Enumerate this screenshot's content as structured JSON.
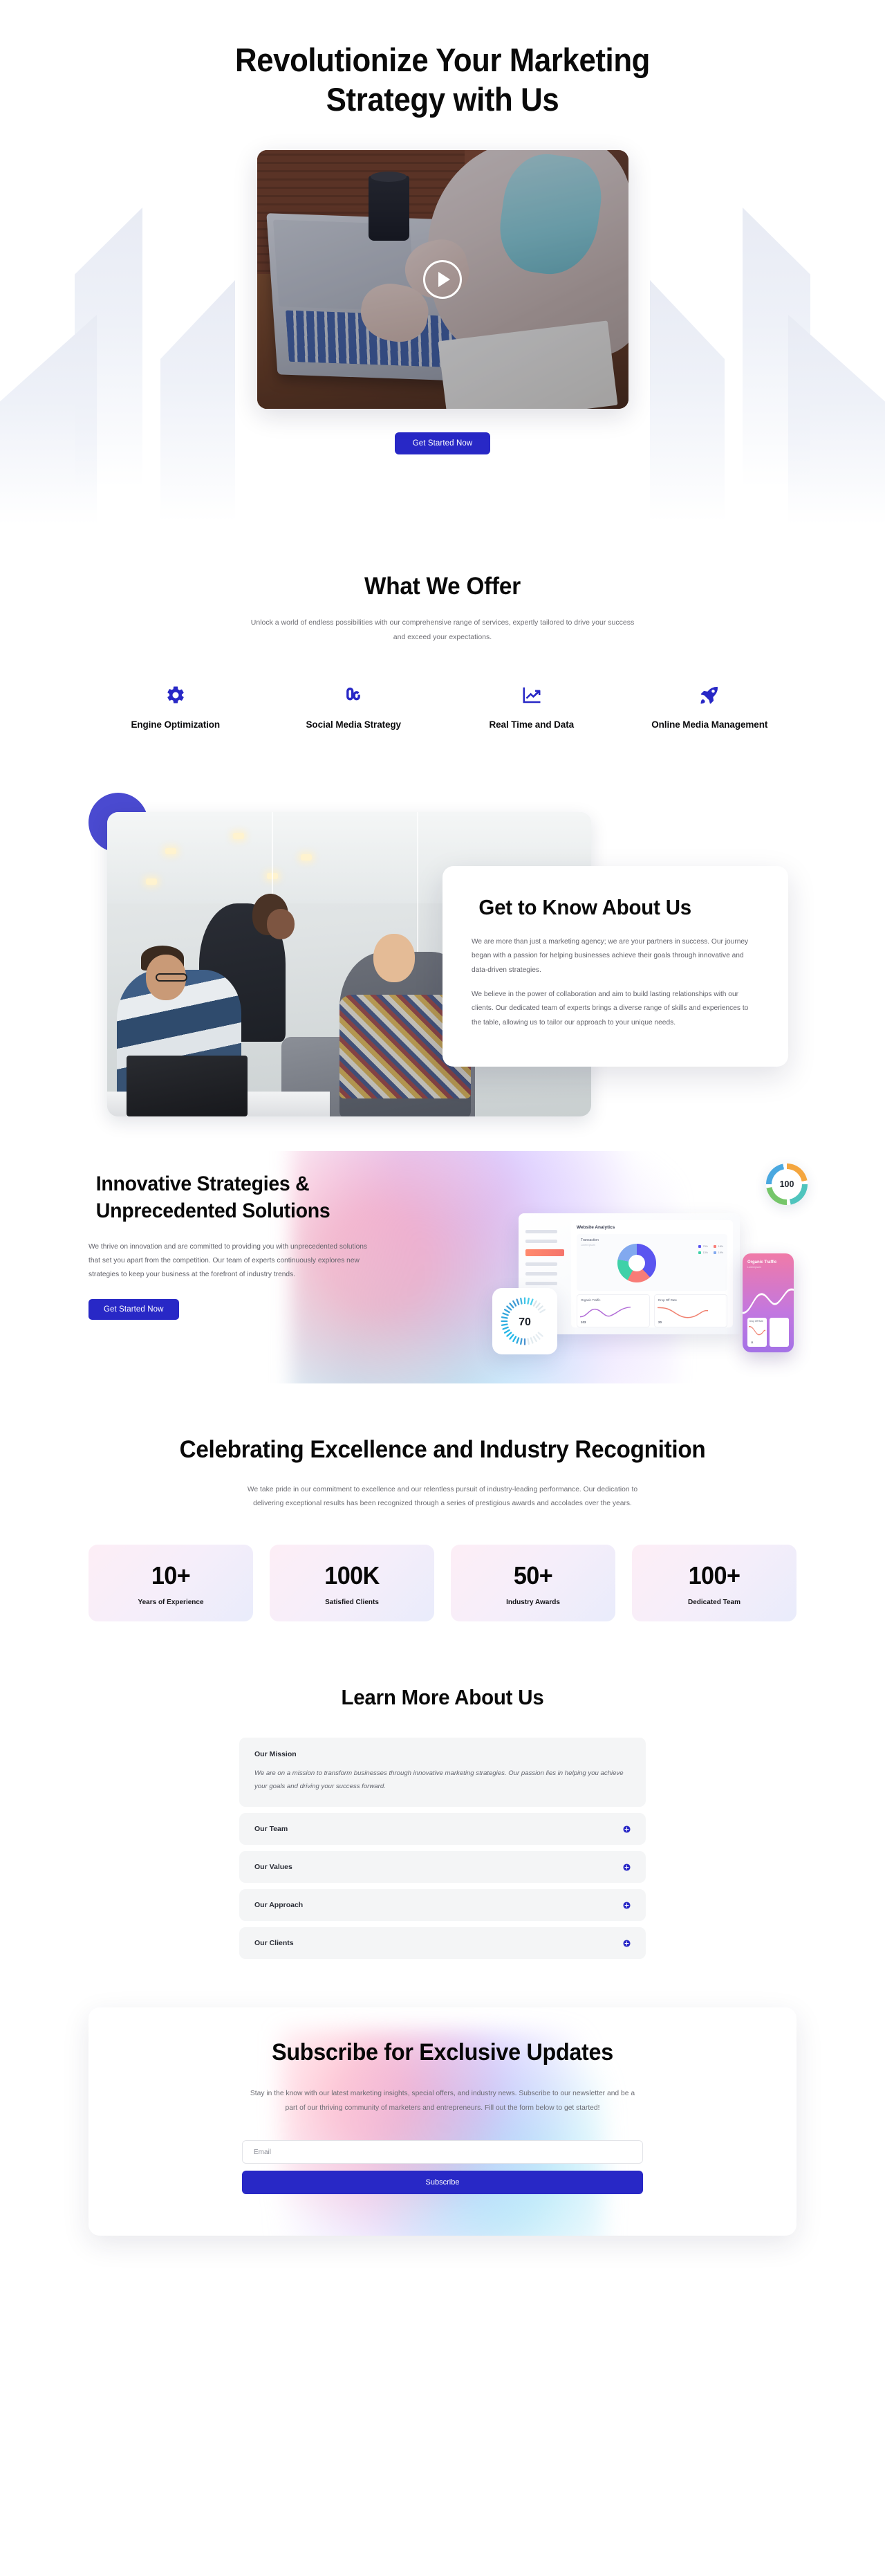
{
  "hero": {
    "title": "Revolutionize Your Marketing Strategy with Us",
    "play_icon": "play-icon",
    "cta_label": "Get Started Now"
  },
  "offer": {
    "title": "What We Offer",
    "subtitle": "Unlock a world of endless possibilities with our comprehensive range of services, expertly tailored to drive your success and exceed your expectations.",
    "services": [
      {
        "icon": "gear-icon",
        "label": "Engine Optimization"
      },
      {
        "icon": "stumbleupon-icon",
        "label": "Social Media Strategy"
      },
      {
        "icon": "chart-line-icon",
        "label": "Real Time and Data"
      },
      {
        "icon": "rocket-icon",
        "label": "Online Media Management"
      }
    ]
  },
  "about": {
    "title": "Get to Know About Us",
    "paragraph1": "We are more than just a marketing agency; we are your partners in success. Our journey began with a passion for helping businesses achieve their goals through innovative and data-driven strategies.",
    "paragraph2": "We believe in the power of collaboration and aim to build lasting relationships with our clients. Our dedicated team of experts brings a diverse range of skills and experiences to the table, allowing us to tailor our approach to your unique needs."
  },
  "innovative": {
    "title": "Innovative Strategies & Unprecedented Solutions",
    "paragraph": "We thrive on innovation and are committed to providing you with unprecedented solutions that set you apart from the competition. Our team of experts continuously explores new strategies to keep your business at the forefront of industry trends.",
    "cta_label": "Get Started Now",
    "dashboard": {
      "app_title": "Website Analytics",
      "panel_title": "Transaction",
      "panel_sub": "Lorem ipsum",
      "legend": [
        {
          "value": "79%",
          "sub": "Lorem ipsum",
          "color": "#5b55f0"
        },
        {
          "value": "18%",
          "sub": "Lorem ipsum",
          "color": "#f87c77"
        },
        {
          "value": "13%",
          "sub": "Lorem ipsum",
          "color": "#3fd1a8"
        },
        {
          "value": "19%",
          "sub": "Lorem ipsum",
          "color": "#82a9ef"
        }
      ],
      "cards": [
        {
          "title": "Organic Traffic",
          "sub": "Lorem ipsum",
          "value": "103"
        },
        {
          "title": "Drop Off Rate",
          "sub": "Lorem ipsum",
          "value": "20"
        }
      ],
      "phone": {
        "title": "Organic Traffic",
        "sub": "Lorem ipsum",
        "card_title": "Drop Off Rate",
        "card_value": "21"
      },
      "gauge_100": "100",
      "gauge_70": "70"
    }
  },
  "awards": {
    "title": "Celebrating Excellence and Industry Recognition",
    "subtitle": "We take pride in our commitment to excellence and our relentless pursuit of industry-leading performance. Our dedication to delivering exceptional results has been recognized through a series of prestigious awards and accolades over the years.",
    "stats": [
      {
        "number": "10+",
        "label": "Years of Experience"
      },
      {
        "number": "100K",
        "label": "Satisfied Clients"
      },
      {
        "number": "50+",
        "label": "Industry Awards"
      },
      {
        "number": "100+",
        "label": "Dedicated Team"
      }
    ]
  },
  "learn": {
    "title": "Learn More About Us",
    "items": [
      {
        "question": "Our Mission",
        "answer": "We are on a mission to transform businesses through innovative marketing strategies. Our passion lies in helping you achieve your goals and driving your success forward.",
        "open": true
      },
      {
        "question": "Our Team",
        "open": false
      },
      {
        "question": "Our Values",
        "open": false
      },
      {
        "question": "Our Approach",
        "open": false
      },
      {
        "question": "Our Clients",
        "open": false
      }
    ]
  },
  "newsletter": {
    "title": "Subscribe for Exclusive Updates",
    "subtitle": "Stay in the know with our latest marketing insights, special offers, and industry news. Subscribe to our newsletter and be a part of our thriving community of marketers and entrepreneurs. Fill out the form below to get started!",
    "email_placeholder": "Email",
    "email_value": "",
    "submit_label": "Subscribe"
  },
  "colors": {
    "accent_blue": "#2828c6",
    "circle_purple": "#4a4ad0",
    "text_dark": "#0a0a0a",
    "text_muted": "#6e6e74"
  }
}
